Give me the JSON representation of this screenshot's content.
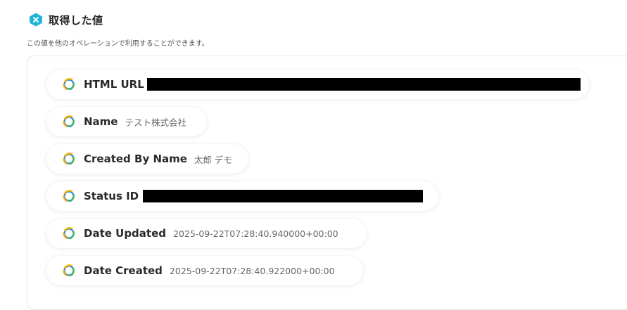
{
  "header": {
    "title": "取得した値",
    "subtitle": "この値を他のオペレーションで利用することができます。"
  },
  "fields": [
    {
      "label": "HTML URL",
      "value": "",
      "redacted": true
    },
    {
      "label": "Name",
      "value": "テスト株式会社",
      "redacted": false
    },
    {
      "label": "Created By Name",
      "value": "太郎 デモ",
      "redacted": false
    },
    {
      "label": "Status ID",
      "value": "",
      "redacted": true
    },
    {
      "label": "Date Updated",
      "value": "2025-09-22T07:28:40.940000+00:00",
      "redacted": false
    },
    {
      "label": "Date Created",
      "value": "2025-09-22T07:28:40.922000+00:00",
      "redacted": false
    }
  ],
  "colors": {
    "accent": "#1fb5d9",
    "icon_blue": "#2f7fe0",
    "icon_yellow": "#f2b705",
    "icon_green": "#3bb85a"
  },
  "icons": {
    "header": "x-badge-icon",
    "field": "integration-app-icon"
  }
}
